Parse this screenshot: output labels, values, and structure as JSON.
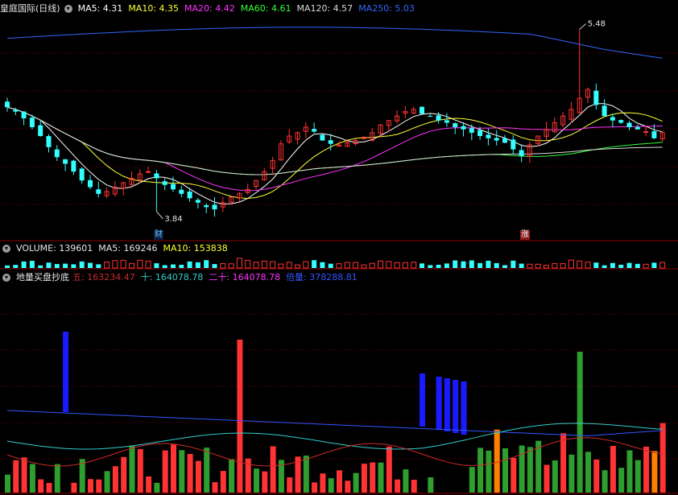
{
  "price_header": {
    "title": "皇庭国际(日线)",
    "ma": [
      {
        "label": "MA5: 4.31",
        "color": "#ffffff"
      },
      {
        "label": "MA10: 4.35",
        "color": "#ffff33"
      },
      {
        "label": "MA20: 4.42",
        "color": "#ff33ff"
      },
      {
        "label": "MA60: 4.61",
        "color": "#33ff33"
      },
      {
        "label": "MA120: 4.57",
        "color": "#d9d9d9"
      },
      {
        "label": "MA250: 5.03",
        "color": "#3366ff"
      }
    ]
  },
  "volume_header": {
    "items": [
      {
        "label": "VOLUME: 139601",
        "color": "#e6e6e6"
      },
      {
        "label": "MA5: 169246",
        "color": "#e6e6e6"
      },
      {
        "label": "MA10: 153838",
        "color": "#ffff33"
      }
    ]
  },
  "indicator_header": {
    "title": "地量买盘抄底",
    "items": [
      {
        "label": "五: 163234.47",
        "color": "#cc2a2a"
      },
      {
        "label": "十: 164078.78",
        "color": "#33cccc"
      },
      {
        "label": "二十: 164078.78",
        "color": "#ff33ff"
      },
      {
        "label": "倍量: 378288.81",
        "color": "#3355ff"
      }
    ]
  },
  "markers": {
    "low_label": "3.84",
    "high_label": "5.48",
    "badge_left": "财",
    "badge_right": "涨"
  },
  "colors": {
    "up": "#ff3333",
    "down": "#33ffff",
    "green_bar": "#2e9e2e",
    "orange_bar": "#ff8000",
    "blue_bar": "#1a1aff",
    "grid": "#8b0000"
  },
  "chart_data": {
    "type": "candlestick",
    "price_range": [
      3.6,
      5.6
    ],
    "low_point": 3.84,
    "high_point": 5.48,
    "closes": [
      4.78,
      4.74,
      4.68,
      4.6,
      4.52,
      4.42,
      4.33,
      4.27,
      4.2,
      4.12,
      4.06,
      4.0,
      4.02,
      4.06,
      4.1,
      4.14,
      4.18,
      4.2,
      4.14,
      4.08,
      4.04,
      4.0,
      3.96,
      3.92,
      3.88,
      3.86,
      3.92,
      3.97,
      4.0,
      4.04,
      4.12,
      4.2,
      4.3,
      4.45,
      4.52,
      4.55,
      4.6,
      4.56,
      4.48,
      4.45,
      4.44,
      4.46,
      4.48,
      4.51,
      4.55,
      4.62,
      4.66,
      4.7,
      4.74,
      4.76,
      4.72,
      4.7,
      4.66,
      4.64,
      4.6,
      4.58,
      4.55,
      4.52,
      4.5,
      4.48,
      4.46,
      4.4,
      4.34,
      4.44,
      4.52,
      4.58,
      4.64,
      4.7,
      4.76,
      4.86,
      4.94,
      4.8,
      4.7,
      4.66,
      4.64,
      4.6,
      4.58,
      4.56,
      4.5,
      4.55
    ],
    "volume_pane": {
      "type": "bar",
      "label": "VOLUME",
      "values": [
        139601
      ],
      "ma5": 169246,
      "ma10": 153838
    },
    "indicator_pane": {
      "type": "bar",
      "lines": {
        "五": 163234.47,
        "十": 164078.78,
        "二十": 164078.78,
        "倍量": 378288.81
      }
    }
  }
}
